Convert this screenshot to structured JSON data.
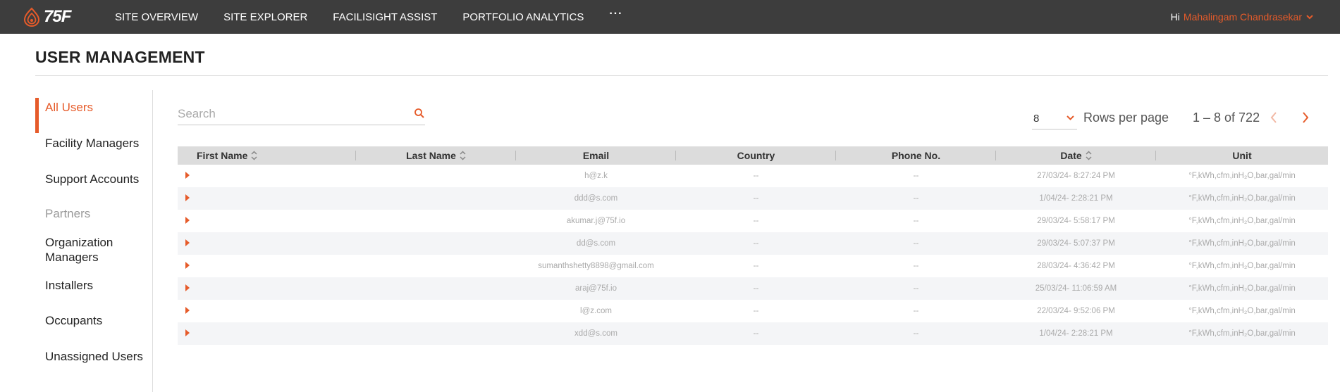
{
  "brand": {
    "logo_text": "75F",
    "accent_color": "#e65b2a",
    "topbar_color": "#3d3d3d"
  },
  "nav": {
    "items": [
      "SITE OVERVIEW",
      "SITE EXPLORER",
      "FACILISIGHT ASSIST",
      "PORTFOLIO ANALYTICS"
    ],
    "more_label": "···"
  },
  "user": {
    "greeting": "Hi",
    "name": "Mahalingam Chandrasekar"
  },
  "page": {
    "title": "USER MANAGEMENT"
  },
  "side_menu": {
    "all_users": "All Users",
    "facility_managers": "Facility Managers",
    "support_accounts": "Support Accounts",
    "partners_heading": "Partners",
    "organization_managers_line1": "Organization",
    "organization_managers_line2": "Managers",
    "installers": "Installers",
    "occupants": "Occupants",
    "unassigned_users": "Unassigned Users"
  },
  "search": {
    "placeholder": "Search",
    "value": ""
  },
  "pagination": {
    "rows_per_page_value": "8",
    "rows_per_page_label": "Rows per page",
    "range": "1 – 8 of 722"
  },
  "table": {
    "columns": [
      "First Name",
      "Last Name",
      "Email",
      "Country",
      "Phone No.",
      "Date",
      "Unit"
    ],
    "rows": [
      {
        "email": "h@z.k",
        "country": "--",
        "phone": "--",
        "date": "27/03/24- 8:27:24 PM",
        "unit": "°F,kWh,cfm,inH₂O,bar,gal/min"
      },
      {
        "email": "ddd@s.com",
        "country": "--",
        "phone": "--",
        "date": "1/04/24- 2:28:21 PM",
        "unit": "°F,kWh,cfm,inH₂O,bar,gal/min"
      },
      {
        "email": "akumar.j@75f.io",
        "country": "--",
        "phone": "--",
        "date": "29/03/24- 5:58:17 PM",
        "unit": "°F,kWh,cfm,inH₂O,bar,gal/min"
      },
      {
        "email": "dd@s.com",
        "country": "--",
        "phone": "--",
        "date": "29/03/24- 5:07:37 PM",
        "unit": "°F,kWh,cfm,inH₂O,bar,gal/min"
      },
      {
        "email": "sumanthshetty8898@gmail.com",
        "country": "--",
        "phone": "--",
        "date": "28/03/24- 4:36:42 PM",
        "unit": "°F,kWh,cfm,inH₂O,bar,gal/min"
      },
      {
        "email": "araj@75f.io",
        "country": "--",
        "phone": "--",
        "date": "25/03/24- 11:06:59 AM",
        "unit": "°F,kWh,cfm,inH₂O,bar,gal/min"
      },
      {
        "email": "l@z.com",
        "country": "--",
        "phone": "--",
        "date": "22/03/24- 9:52:06 PM",
        "unit": "°F,kWh,cfm,inH₂O,bar,gal/min"
      },
      {
        "email": "xdd@s.com",
        "country": "--",
        "phone": "--",
        "date": "1/04/24- 2:28:21 PM",
        "unit": "°F,kWh,cfm,inH₂O,bar,gal/min"
      }
    ]
  }
}
